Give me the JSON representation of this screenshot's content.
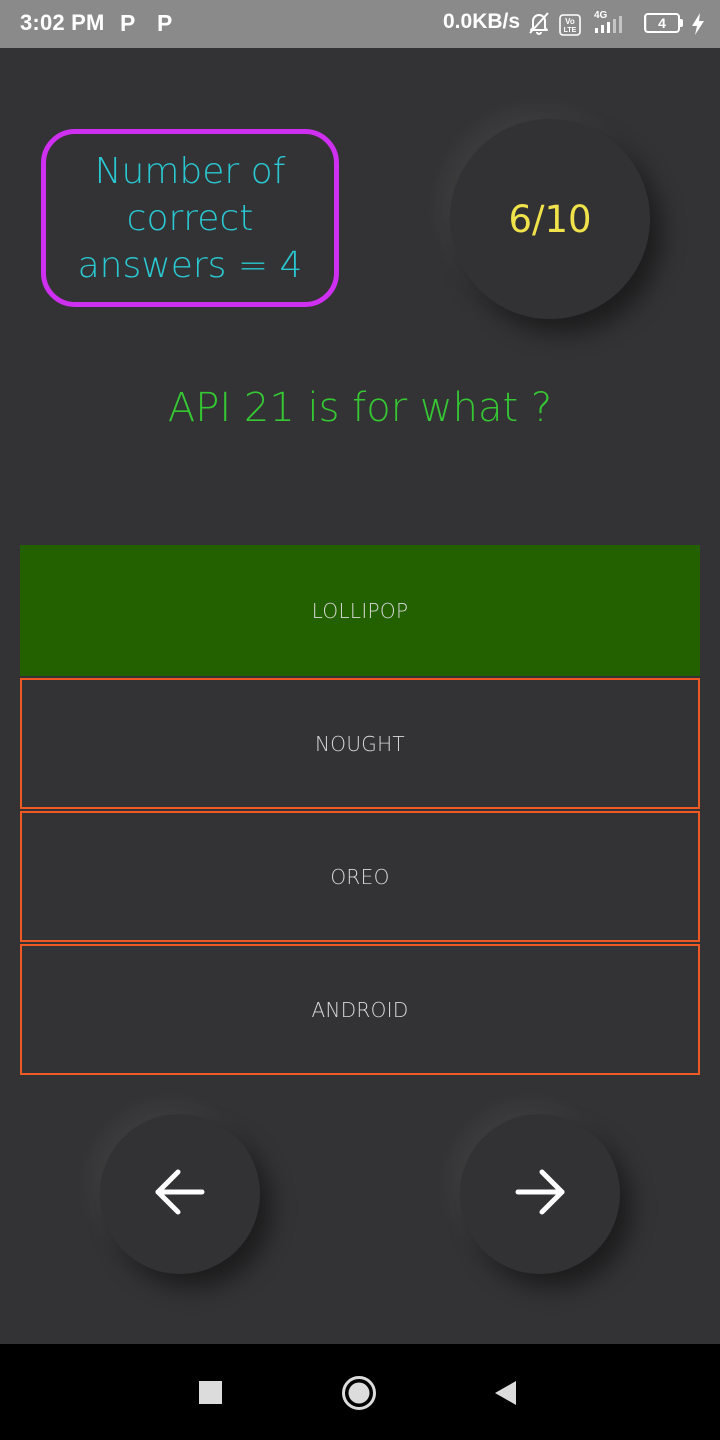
{
  "status_bar": {
    "time": "3:02 PM",
    "notif_icons": [
      "P",
      "P"
    ],
    "net_speed": "0.0KB/s",
    "network": "4G",
    "volte": "Vo LTE",
    "battery_label": "4",
    "battery_fraction": 0.04
  },
  "quiz": {
    "score_text": "Number of correct answers = 4",
    "progress": "6/10",
    "question": "API 21 is for what ?",
    "options": [
      "LOLLIPOP",
      "NOUGHT",
      "OREO",
      "ANDROID"
    ],
    "selected_index": 0
  },
  "icons": {
    "prev": "arrow-left-icon",
    "next": "arrow-right-icon",
    "recents": "square-icon",
    "home": "circle-icon",
    "back": "triangle-back-icon"
  },
  "colors": {
    "background": "#333335",
    "score_border": "#cf2ff0",
    "score_text": "#29c8d2",
    "progress_text": "#f0e24a",
    "question_text": "#35c832",
    "option_border": "#ef5a24",
    "option_correct": "#236000"
  }
}
